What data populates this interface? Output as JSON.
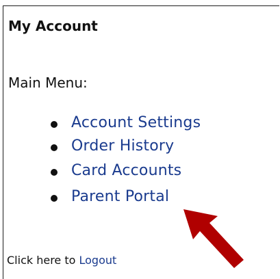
{
  "panel": {
    "title": "My Account",
    "menu_label": "Main Menu:"
  },
  "menu": {
    "items": [
      {
        "label": "Account Settings"
      },
      {
        "label": "Order History"
      },
      {
        "label": "Card Accounts"
      },
      {
        "label": "Parent Portal"
      }
    ]
  },
  "footer": {
    "prefix": "Click here to ",
    "logout_label": "Logout"
  },
  "annotation": {
    "arrow_color": "#b00000",
    "arrow_target": "Parent Portal"
  },
  "colors": {
    "link": "#1a3b8e",
    "text": "#111111"
  }
}
